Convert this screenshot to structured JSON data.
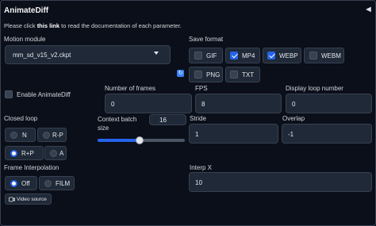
{
  "header": {
    "title": "AnimateDiff"
  },
  "info": {
    "prefix": "Please click ",
    "link": "this link",
    "suffix": " to read the documentation of each parameter."
  },
  "motion_module": {
    "label": "Motion module",
    "value": "mm_sd_v15_v2.ckpt"
  },
  "save_format": {
    "label": "Save format",
    "options": [
      {
        "label": "GIF",
        "checked": false
      },
      {
        "label": "MP4",
        "checked": true
      },
      {
        "label": "WEBP",
        "checked": true
      },
      {
        "label": "WEBM",
        "checked": false
      },
      {
        "label": "PNG",
        "checked": false
      },
      {
        "label": "TXT",
        "checked": false
      }
    ]
  },
  "enable": {
    "label": "Enable AnimateDiff",
    "checked": false
  },
  "number_of_frames": {
    "label": "Number of frames",
    "value": "0"
  },
  "fps": {
    "label": "FPS",
    "value": "8"
  },
  "display_loop_number": {
    "label": "Display loop number",
    "value": "0"
  },
  "closed_loop": {
    "label": "Closed loop",
    "options": [
      "N",
      "R-P",
      "R+P",
      "A"
    ],
    "selected": "R+P"
  },
  "context_batch_size": {
    "label": "Context batch size",
    "value": "16",
    "min": 1,
    "max": 32
  },
  "stride": {
    "label": "Stride",
    "value": "1"
  },
  "overlap": {
    "label": "Overlap",
    "value": "-1"
  },
  "frame_interpolation": {
    "label": "Frame Interpolation",
    "options": [
      "Off",
      "FILM"
    ],
    "selected": "Off"
  },
  "interp_x": {
    "label": "Interp X",
    "value": "10"
  },
  "video_source": {
    "label": "Video source"
  },
  "colors": {
    "accent": "#2563eb",
    "background": "#0b0f19",
    "field": "#1f2937",
    "border": "#374151"
  }
}
